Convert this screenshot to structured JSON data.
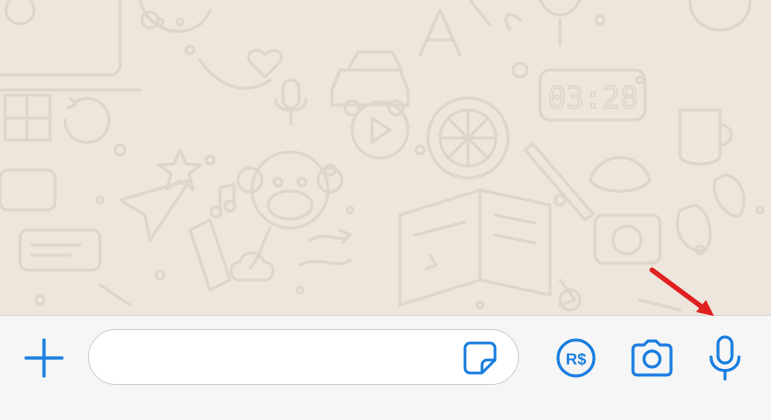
{
  "chat": {
    "background_color": "#ece6dd",
    "doodle_color": "#ddd6cc",
    "clock_display": "03:28"
  },
  "input_bar": {
    "accent_color": "#1a7ee0",
    "attach_icon": "plus-icon",
    "message_input": {
      "value": "",
      "placeholder": ""
    },
    "sticker_icon": "sticker-icon",
    "payment_icon": "pix-payment-icon",
    "payment_label": "R$",
    "camera_icon": "camera-icon",
    "mic_icon": "microphone-icon"
  },
  "annotation": {
    "arrow_color": "#e02020",
    "points_to": "microphone-button"
  }
}
